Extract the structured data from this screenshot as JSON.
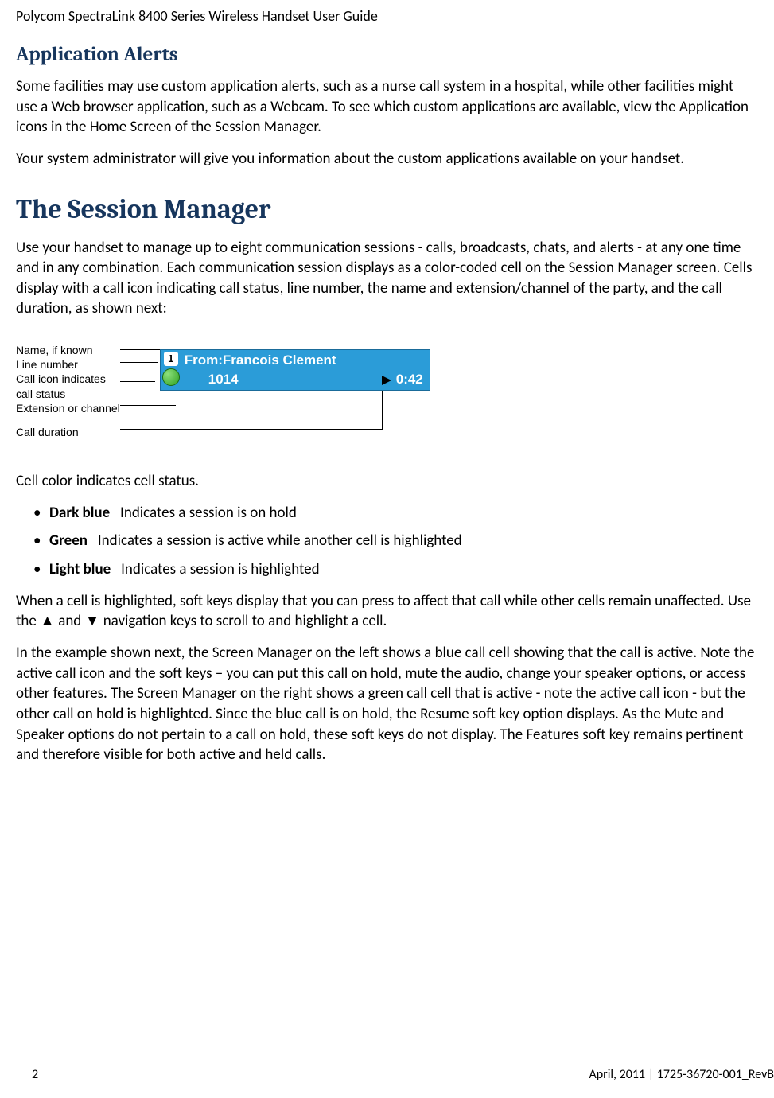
{
  "header": "Polycom SpectraLink 8400 Series Wireless Handset User Guide",
  "h2_1": "Application Alerts",
  "p1": "Some facilities may use custom application alerts, such as a nurse call system in a hospital, while other facilities might use a Web browser application, such as a Webcam. To see which custom applications are available, view the Application icons in the Home Screen of the Session Manager.",
  "p2": "Your system administrator will give you information about the custom applications available on your handset.",
  "h1_1": "The Session Manager",
  "p3": "Use your handset to manage up to eight communication sessions - calls, broadcasts, chats, and alerts - at any one time and in any combination. Each communication session displays as a color-coded cell on the Session Manager screen. Cells display with a call icon indicating call status, line number, the name and extension/channel of the party, and the call duration, as shown next:",
  "diagram": {
    "labels": {
      "name": "Name, if known",
      "line": "Line number",
      "icon1": "Call icon indicates",
      "icon2": "call status",
      "ext": "Extension or channel",
      "dur": "Call duration"
    },
    "cell": {
      "line_num": "1",
      "from": "From:Francois Clement",
      "ext": "1014",
      "dur": "0:42"
    }
  },
  "p4": "Cell color indicates cell status.",
  "bullets": [
    {
      "bold": "Dark blue",
      "rest": " Indicates a session is on hold"
    },
    {
      "bold": "Green",
      "rest": " Indicates a session is active while another cell is highlighted"
    },
    {
      "bold": "Light blue",
      "rest": " Indicates a session is highlighted"
    }
  ],
  "p5a": "When a cell is highlighted, soft keys display that you can press to affect that call while other cells remain unaffected. Use the ",
  "up": "▲",
  "p5b": " and ",
  "down": "▼",
  "p5c": " navigation keys to scroll to and highlight a cell.",
  "p6": "In the example shown next, the Screen Manager on the left shows a blue call cell showing that the call is active. Note the active call icon and the soft keys – you can put this call on hold, mute the audio, change your speaker options, or access other features. The Screen Manager on the right shows a green call cell that is active - note the active call icon - but the other call on hold is highlighted. Since the blue call is on hold, the Resume soft key option displays. As the Mute and Speaker options do not pertain to a call on hold, these soft keys do not display. The Features soft key remains pertinent and therefore visible for both active and held calls.",
  "footer": {
    "page": "2",
    "date": "April, 2011  |  1725-36720-001_RevB"
  }
}
